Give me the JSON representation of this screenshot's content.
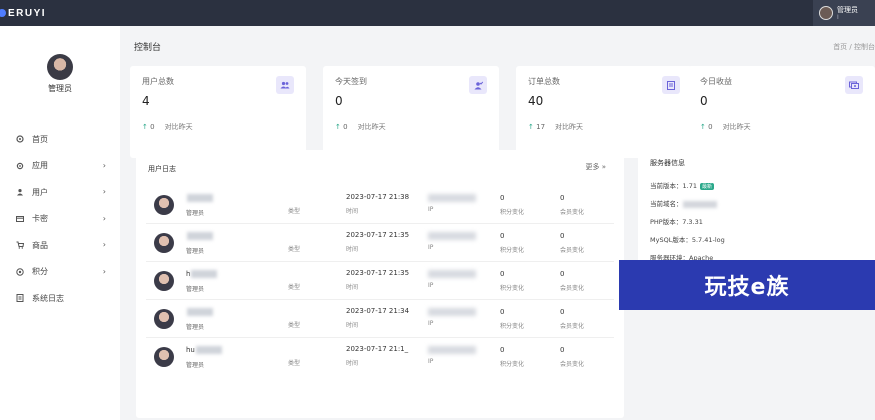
{
  "topbar": {
    "brand": "ERUYI",
    "user_name": "管理员",
    "user_sub": "I"
  },
  "sidebar": {
    "profile_name": "管理员",
    "items": [
      {
        "label": "首页",
        "icon": "dashboard-icon",
        "has_arrow": false
      },
      {
        "label": "应用",
        "icon": "gear-icon",
        "has_arrow": true
      },
      {
        "label": "用户",
        "icon": "user-icon",
        "has_arrow": true
      },
      {
        "label": "卡密",
        "icon": "card-icon",
        "has_arrow": true
      },
      {
        "label": "商品",
        "icon": "cart-icon",
        "has_arrow": true
      },
      {
        "label": "积分",
        "icon": "coin-icon",
        "has_arrow": true
      },
      {
        "label": "系统日志",
        "icon": "log-icon",
        "has_arrow": false
      }
    ]
  },
  "page": {
    "title": "控制台",
    "breadcrumb": "首页 / 控制台"
  },
  "stats": [
    {
      "title": "用户总数",
      "value": "4",
      "change": "0",
      "compare": "对比昨天",
      "icon": "users-icon"
    },
    {
      "title": "今天签到",
      "value": "0",
      "change": "0",
      "compare": "对比昨天",
      "icon": "checkin-icon"
    },
    {
      "title": "订单总数",
      "value": "40",
      "change": "17",
      "compare": "对比昨天",
      "icon": "order-icon"
    },
    {
      "title": "今日收益",
      "value": "0",
      "change": "0",
      "compare": "对比昨天",
      "icon": "money-icon"
    }
  ],
  "log": {
    "title": "用户日志",
    "more": "更多",
    "rows": [
      {
        "user": "",
        "role": "管理员",
        "type": "类型",
        "time": "2023-07-17 21:38",
        "time_label": "时间",
        "ip_label": "IP",
        "points": "0",
        "points_label": "积分变化",
        "member": "0",
        "member_label": "会员变化"
      },
      {
        "user": "",
        "role": "管理员",
        "type": "类型",
        "time": "2023-07-17 21:35",
        "time_label": "时间",
        "ip_label": "IP",
        "points": "0",
        "points_label": "积分变化",
        "member": "0",
        "member_label": "会员变化"
      },
      {
        "user": "h",
        "role": "管理员",
        "type": "类型",
        "time": "2023-07-17 21:35",
        "time_label": "时间",
        "ip_label": "IP",
        "points": "0",
        "points_label": "积分变化",
        "member": "0",
        "member_label": "会员变化"
      },
      {
        "user": "",
        "role": "管理员",
        "type": "类型",
        "time": "2023-07-17 21:34",
        "time_label": "时间",
        "ip_label": "IP",
        "points": "0",
        "points_label": "积分变化",
        "member": "0",
        "member_label": "会员变化"
      },
      {
        "user": "hu",
        "role": "管理员",
        "type": "类型",
        "time": "2023-07-17 21:1_",
        "time_label": "时间",
        "ip_label": "IP",
        "points": "0",
        "points_label": "积分变化",
        "member": "0",
        "member_label": "会员变化"
      }
    ]
  },
  "server": {
    "title": "服务器信息",
    "version_label": "当前版本：",
    "version": "1.71",
    "version_badge": "最新",
    "domain_label": "当前域名：",
    "php_label": "PHP版本：",
    "php": "7.3.31",
    "mysql_label": "MySQL版本：",
    "mysql": "5.7.41-log",
    "env_label": "服务器环境：",
    "env": "Apache"
  },
  "watermark": "玩技e族",
  "colors": {
    "topbar": "#2b3140",
    "accent": "#6b63d9",
    "up": "#2aa88a",
    "watermark": "#2b3ab0"
  }
}
